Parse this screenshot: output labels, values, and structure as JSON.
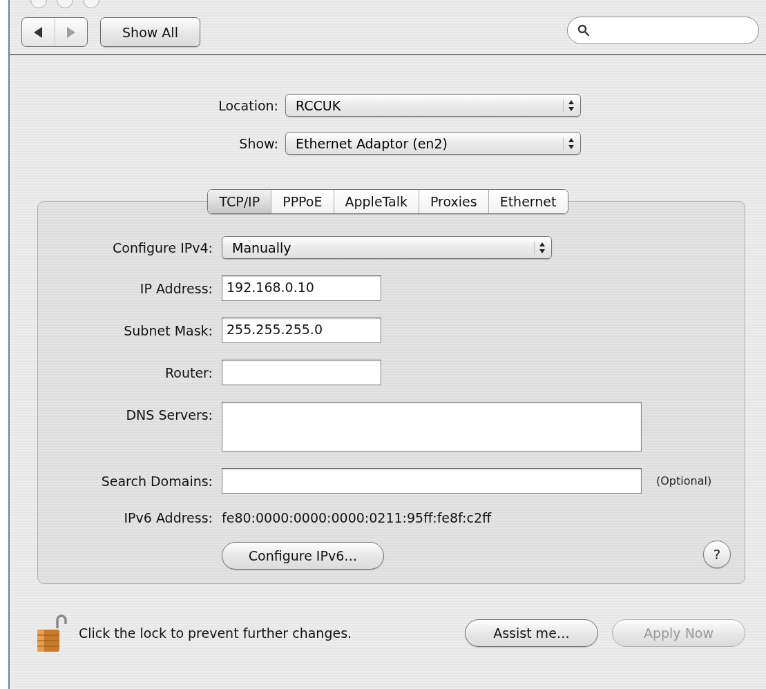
{
  "toolbar": {
    "nav_buttons": [
      {
        "kind": "back",
        "disabled": false
      },
      {
        "kind": "forward",
        "disabled": true
      }
    ],
    "show_all": "Show All"
  },
  "location": {
    "label": "Location:",
    "value": "RCCUK"
  },
  "show": {
    "label": "Show:",
    "value": "Ethernet Adaptor (en2)"
  },
  "tabs": [
    {
      "label": "TCP/IP",
      "selected": true
    },
    {
      "label": "PPPoE",
      "selected": false
    },
    {
      "label": "AppleTalk",
      "selected": false
    },
    {
      "label": "Proxies",
      "selected": false
    },
    {
      "label": "Ethernet",
      "selected": false
    }
  ],
  "configure_ipv4": {
    "label": "Configure IPv4:",
    "value": "Manually"
  },
  "fields": [
    {
      "kind": "short",
      "label": "IP Address:",
      "value": "192.168.0.10"
    },
    {
      "kind": "short",
      "label": "Subnet Mask:",
      "value": "255.255.255.0"
    },
    {
      "kind": "short",
      "label": "Router:"
    },
    {
      "kind": "tall",
      "label": "DNS Servers:"
    },
    {
      "kind": "wide",
      "label": "Search Domains:",
      "note": "(Optional)"
    }
  ],
  "ipv6": {
    "label": "IPv6 Address:",
    "value": "fe80:0000:0000:0000:0211:95ff:fe8f:c2ff"
  },
  "configure_ipv6": "Configure IPv6…",
  "help": "?",
  "footer": {
    "locked": false,
    "message": "Click the lock to prevent further changes.",
    "buttons": [
      {
        "label": "Assist me…",
        "disabled": false
      },
      {
        "label": "Apply Now",
        "disabled": true
      }
    ]
  }
}
